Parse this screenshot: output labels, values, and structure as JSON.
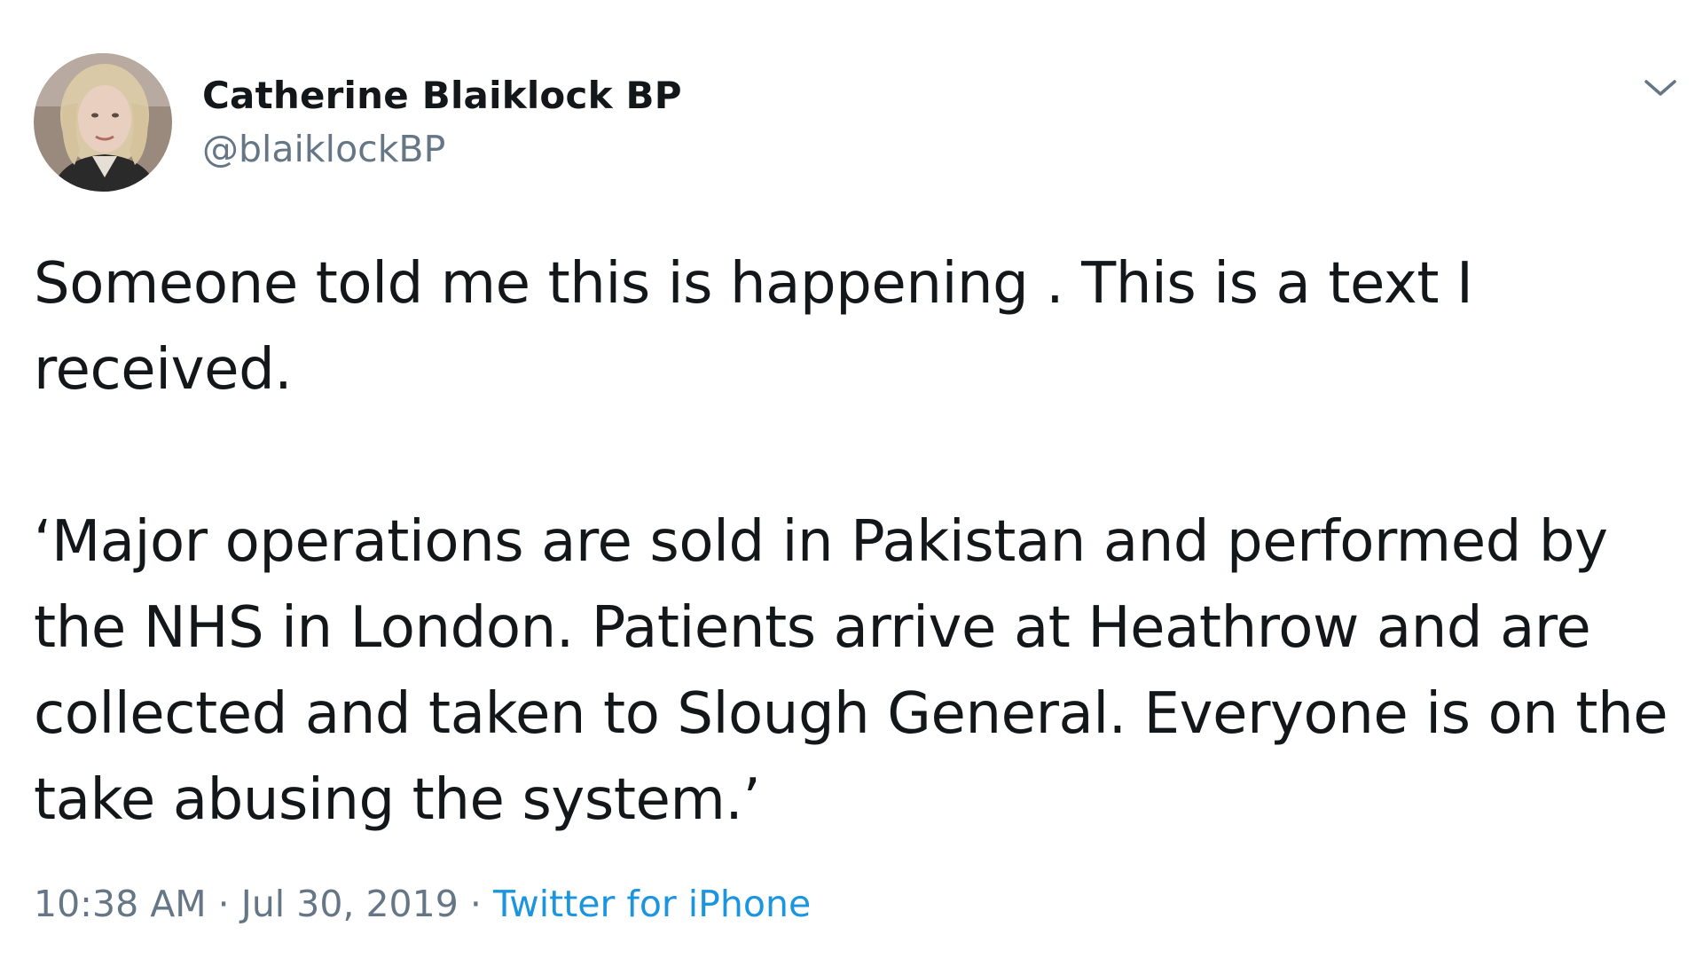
{
  "author": {
    "display_name": "Catherine Blaiklock BP",
    "handle": "@blaiklockBP",
    "avatar_icon": "profile-photo"
  },
  "menu": {
    "icon": "chevron-down-icon"
  },
  "tweet": {
    "paragraphs": [
      "Someone told me this is happening . This is a text I received.",
      "‘Major operations are sold in Pakistan and performed by the NHS in London. Patients arrive at Heathrow and are collected and taken to Slough General.  Everyone is on the take abusing the system.’"
    ]
  },
  "meta": {
    "time": "10:38 AM",
    "separator": " · ",
    "date": "Jul 30, 2019",
    "separator2": " · ",
    "source": "Twitter for iPhone"
  },
  "colors": {
    "text": "#14171a",
    "secondary": "#657786",
    "link": "#1b95e0"
  }
}
